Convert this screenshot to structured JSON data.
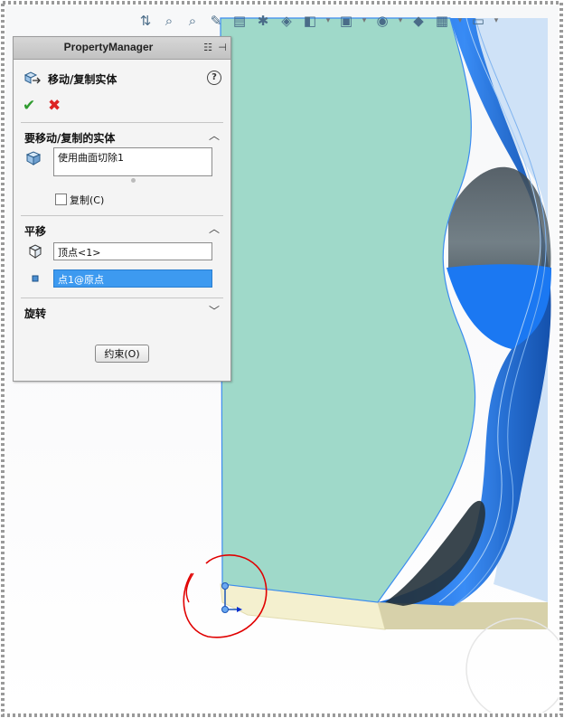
{
  "toolbar": {
    "icons": [
      "view-orientation-icon",
      "zoom-to-fit-icon",
      "zoom-area-icon",
      "previous-view-icon",
      "section-view-icon",
      "dynamic-annotation-icon",
      "view-orientation-cube-icon",
      "display-style-icon",
      "hide-show-icon",
      "edit-appearance-icon",
      "apply-scene-icon",
      "view-settings-icon"
    ]
  },
  "property_manager": {
    "title": "PropertyManager",
    "feature_name": "移动/复制实体",
    "help": "?",
    "ok": "✔",
    "cancel": "✖",
    "bodies_group": {
      "title": "要移动/复制的实体",
      "selected_body": "使用曲面切除1",
      "copy_label": "复制(C)",
      "copy_checked": false
    },
    "translate_group": {
      "title": "平移",
      "from_value": "顶点<1>",
      "to_value": "点1@原点"
    },
    "rotate_group": {
      "title": "旋转"
    },
    "constraint_button": "约束(O)"
  },
  "colors": {
    "body_face": "#9fd9c9",
    "body_edge": "#3b8cf0",
    "highlight_blue": "#1a73e8",
    "base_face": "#f4f0cf",
    "annotation_red": "#e00000"
  }
}
